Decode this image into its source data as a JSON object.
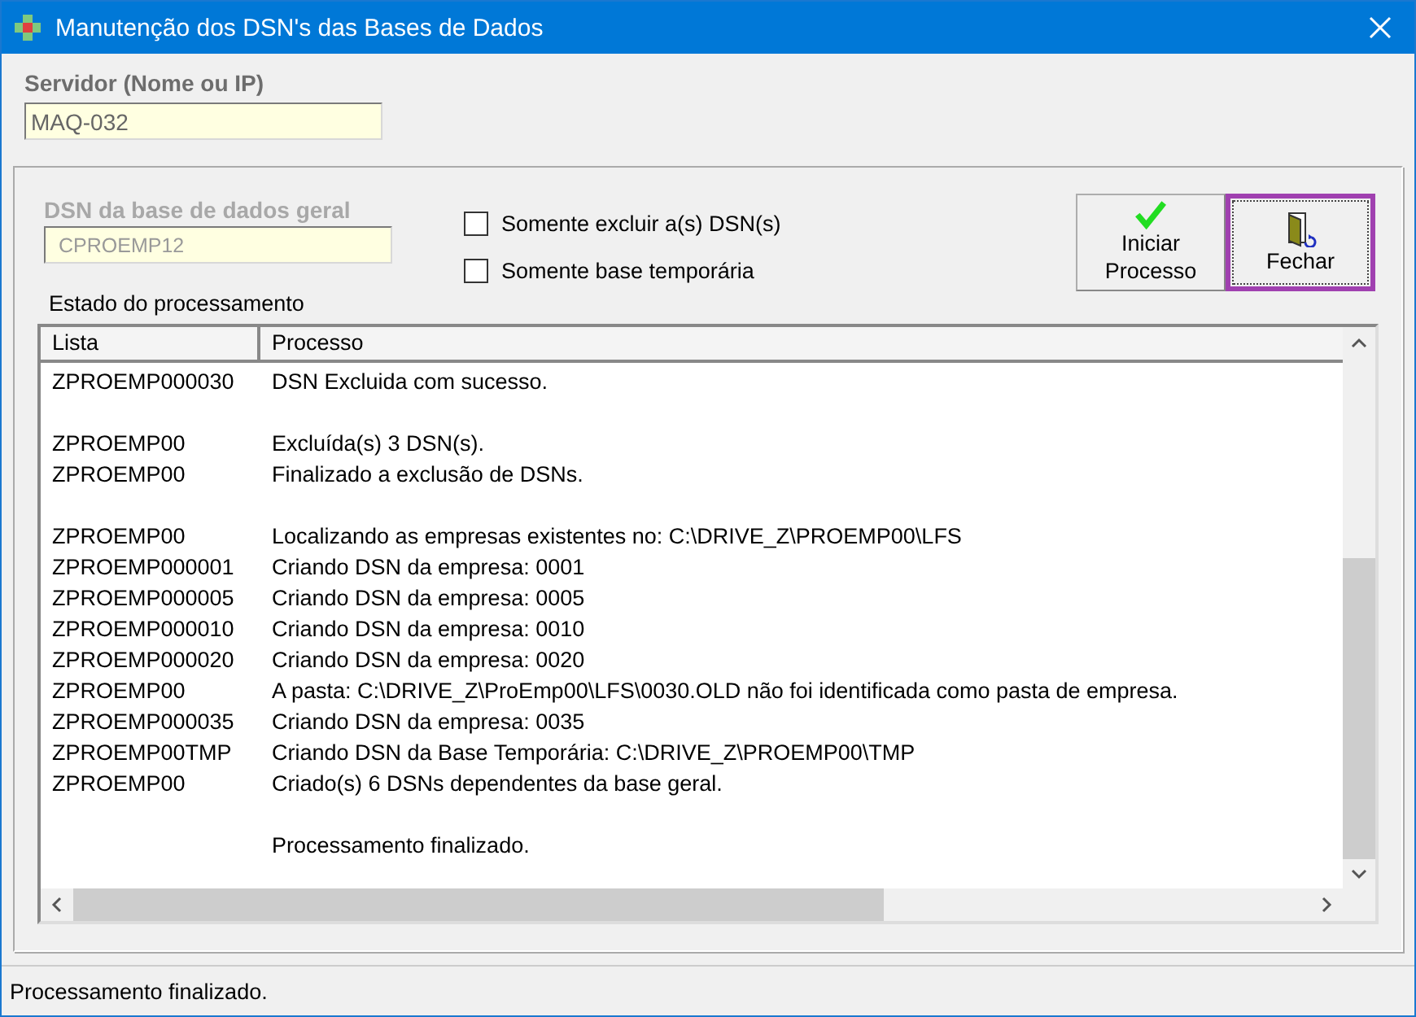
{
  "window": {
    "title": "Manutenção dos DSN's das Bases de Dados"
  },
  "server": {
    "label": "Servidor (Nome ou IP)",
    "value": "MAQ-032"
  },
  "dsn": {
    "label": "DSN da base de dados geral",
    "value": "CPROEMP12"
  },
  "options": [
    {
      "label": "Somente excluir a(s) DSN(s)",
      "checked": false
    },
    {
      "label": "Somente base temporária",
      "checked": false
    }
  ],
  "buttons": [
    {
      "label_lines": [
        "Iniciar",
        "Processo"
      ],
      "kind": "start",
      "focused": false
    },
    {
      "label_lines": [
        "Fechar"
      ],
      "kind": "close",
      "focused": true
    }
  ],
  "list": {
    "label": "Estado do processamento",
    "columns": [
      "Lista",
      "Processo"
    ],
    "rows": [
      {
        "kind": "row",
        "lista": "ZPROEMP000030",
        "processo": "DSN Excluida com sucesso."
      },
      {
        "kind": "blank"
      },
      {
        "kind": "row",
        "lista": "ZPROEMP00",
        "processo": "Excluída(s) 3 DSN(s)."
      },
      {
        "kind": "row",
        "lista": "ZPROEMP00",
        "processo": "Finalizado a exclusão de DSNs."
      },
      {
        "kind": "blank"
      },
      {
        "kind": "row",
        "lista": "ZPROEMP00",
        "processo": "Localizando as empresas existentes no: C:\\DRIVE_Z\\PROEMP00\\LFS"
      },
      {
        "kind": "row",
        "lista": "ZPROEMP000001",
        "processo": "Criando DSN da empresa: 0001"
      },
      {
        "kind": "row",
        "lista": "ZPROEMP000005",
        "processo": "Criando DSN da empresa: 0005"
      },
      {
        "kind": "row",
        "lista": "ZPROEMP000010",
        "processo": "Criando DSN da empresa: 0010"
      },
      {
        "kind": "row",
        "lista": "ZPROEMP000020",
        "processo": "Criando DSN da empresa: 0020"
      },
      {
        "kind": "row",
        "lista": "ZPROEMP00",
        "processo": "A pasta: C:\\DRIVE_Z\\ProEmp00\\LFS\\0030.OLD não foi identificada como pasta de empresa."
      },
      {
        "kind": "row",
        "lista": "ZPROEMP000035",
        "processo": "Criando DSN da empresa: 0035"
      },
      {
        "kind": "row",
        "lista": "ZPROEMP00TMP",
        "processo": "Criando DSN da Base Temporária: C:\\DRIVE_Z\\PROEMP00\\TMP"
      },
      {
        "kind": "row",
        "lista": "ZPROEMP00",
        "processo": "Criado(s) 6 DSNs dependentes da base geral."
      },
      {
        "kind": "blank"
      },
      {
        "kind": "row",
        "processo": "Processamento finalizado."
      }
    ]
  },
  "status_bar": {
    "text": "Processamento finalizado."
  }
}
